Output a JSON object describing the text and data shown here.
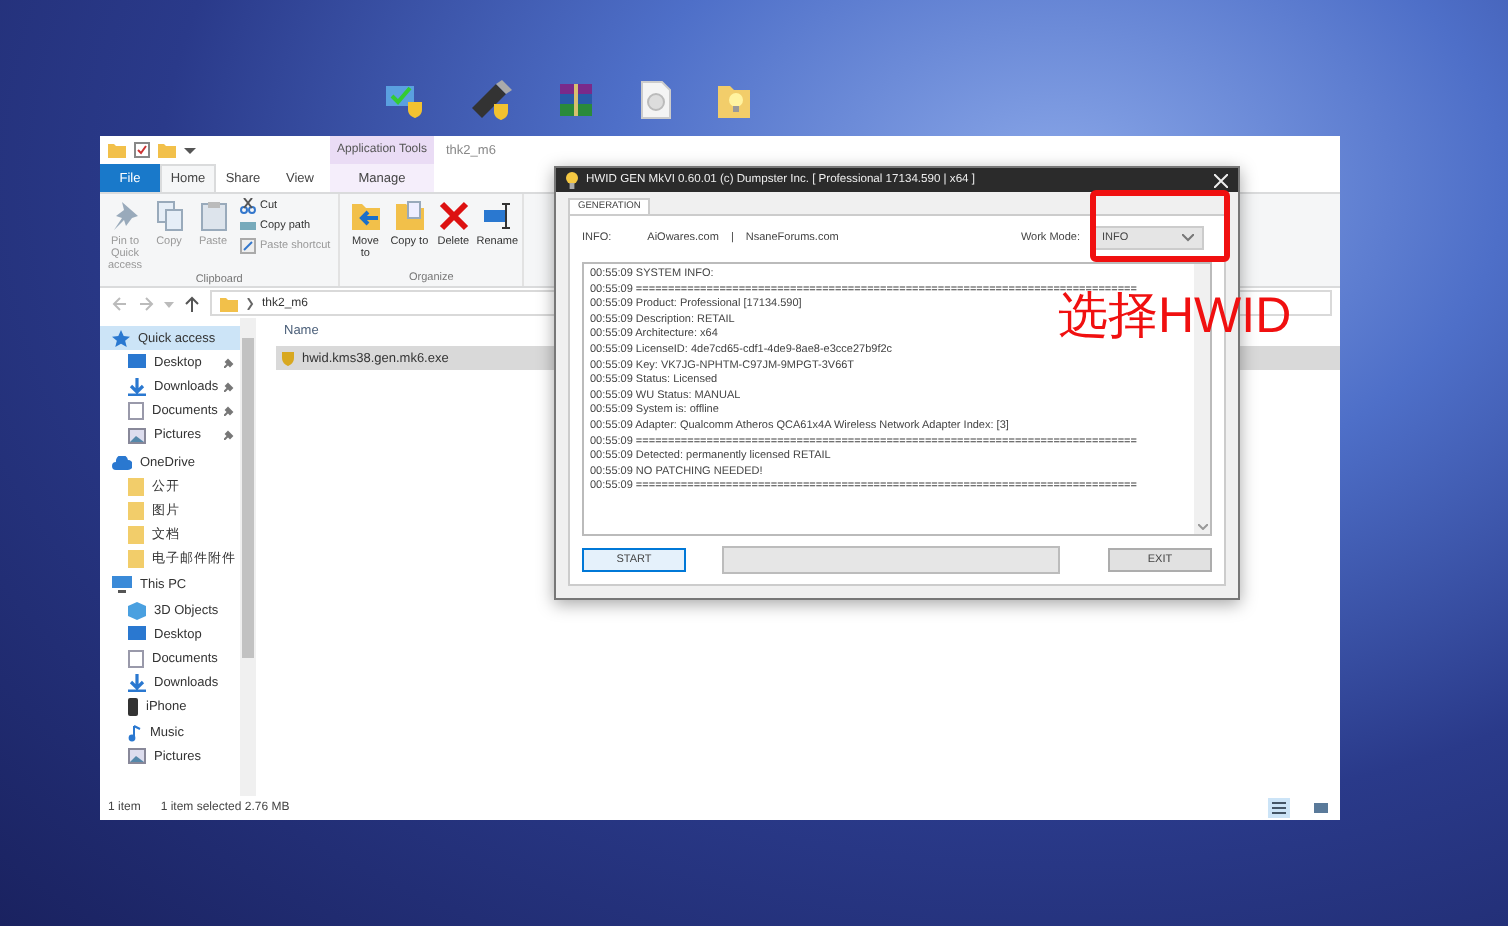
{
  "explorer": {
    "title": "thk2_m6",
    "context_tab": "Application Tools",
    "tabs": [
      {
        "label": "File",
        "selected": false
      },
      {
        "label": "Home",
        "selected": true
      },
      {
        "label": "Share",
        "selected": false
      },
      {
        "label": "View",
        "selected": false
      },
      {
        "label": "Manage",
        "selected": false
      }
    ],
    "ribbon": {
      "groups": [
        {
          "label": "Clipboard",
          "large": [
            {
              "label": "Pin to Quick access",
              "disabled": true
            },
            {
              "label": "Copy",
              "disabled": true
            },
            {
              "label": "Paste",
              "disabled": true
            }
          ],
          "small": [
            {
              "label": "Cut",
              "disabled": false
            },
            {
              "label": "Copy path",
              "disabled": false
            },
            {
              "label": "Paste shortcut",
              "disabled": true
            }
          ]
        },
        {
          "label": "Organize",
          "large": [
            {
              "label": "Move to",
              "disabled": false
            },
            {
              "label": "Copy to",
              "disabled": false
            },
            {
              "label": "Delete",
              "disabled": false
            },
            {
              "label": "Rename",
              "disabled": false
            }
          ]
        }
      ]
    },
    "address": {
      "breadcrumb": "thk2_m6"
    },
    "nav": [
      {
        "label": "Quick access",
        "selected": true,
        "children": [
          {
            "label": "Desktop",
            "pinned": true,
            "selected": false
          },
          {
            "label": "Downloads",
            "pinned": true,
            "selected": false
          },
          {
            "label": "Documents",
            "pinned": true,
            "selected": false
          },
          {
            "label": "Pictures",
            "pinned": true,
            "selected": false
          }
        ]
      },
      {
        "label": "OneDrive",
        "selected": false,
        "children": [
          {
            "label": "公开",
            "selected": false
          },
          {
            "label": "图片",
            "selected": false
          },
          {
            "label": "文档",
            "selected": false
          },
          {
            "label": "电子邮件附件",
            "selected": false
          }
        ]
      },
      {
        "label": "This PC",
        "selected": false,
        "children": [
          {
            "label": "3D Objects",
            "selected": false
          },
          {
            "label": "Desktop",
            "selected": false
          },
          {
            "label": "Documents",
            "selected": false
          },
          {
            "label": "Downloads",
            "selected": false
          },
          {
            "label": "iPhone",
            "selected": false
          },
          {
            "label": "Music",
            "selected": false
          },
          {
            "label": "Pictures",
            "selected": false
          }
        ]
      }
    ],
    "table": {
      "columns": [
        "Name"
      ],
      "rows": [
        {
          "cells": [
            "hwid.kms38.gen.mk6.exe"
          ],
          "selected": true
        }
      ]
    },
    "status_bar": {
      "count": "1 item",
      "selection": "1 item selected  2.76 MB"
    }
  },
  "hwid_gen": {
    "title": "HWID GEN MkVI 0.60.01 (c) Dumpster Inc. [ Professional 17134.590 | x64 ]",
    "tab": "GENERATION",
    "info_label": "INFO:",
    "links": [
      "AiOwares.com",
      "|",
      "NsaneForums.com"
    ],
    "work_mode_label": "Work Mode:",
    "work_mode": "INFO",
    "log": [
      "00:55:09 SYSTEM INFO:",
      "00:55:09 ==============================================================================",
      "00:55:09 Product: Professional [17134.590]",
      "00:55:09 Description: RETAIL",
      "00:55:09 Architecture: x64",
      "00:55:09 LicenseID: 4de7cd65-cdf1-4de9-8ae8-e3cce27b9f2c",
      "00:55:09 Key: VK7JG-NPHTM-C97JM-9MPGT-3V66T",
      "00:55:09 Status: Licensed",
      "00:55:09 WU Status: MANUAL",
      "00:55:09 System is: offline",
      "00:55:09 Adapter: Qualcomm Atheros QCA61x4A Wireless Network Adapter Index: [3]",
      "00:55:09 ==============================================================================",
      "00:55:09 Detected: permanently licensed RETAIL",
      "00:55:09 NO PATCHING NEEDED!",
      "00:55:09 =============================================================================="
    ],
    "buttons": [
      "START",
      "EXIT"
    ],
    "progress": {
      "level": 0
    }
  },
  "annotation": {
    "text": "选择HWID"
  }
}
